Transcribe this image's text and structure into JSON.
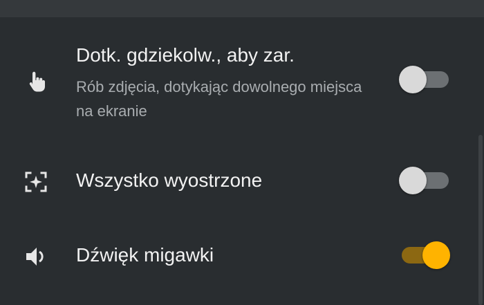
{
  "settings": {
    "items": [
      {
        "title": "Dotk. gdziekolw., aby zar.",
        "subtitle": "Rób zdjęcia, dotykając dowolnego miejsca na ekranie",
        "icon": "tap-finger-icon",
        "enabled": false
      },
      {
        "title": "Wszystko wyostrzone",
        "icon": "focus-sparkle-icon",
        "enabled": false
      },
      {
        "title": "Dźwięk migawki",
        "icon": "speaker-icon",
        "enabled": true
      }
    ]
  },
  "colors": {
    "background": "#292d30",
    "accent_on": "#ffb300",
    "track_on": "#8c6812",
    "thumb_off": "#d9d9d9",
    "track_off": "#6c7073"
  }
}
